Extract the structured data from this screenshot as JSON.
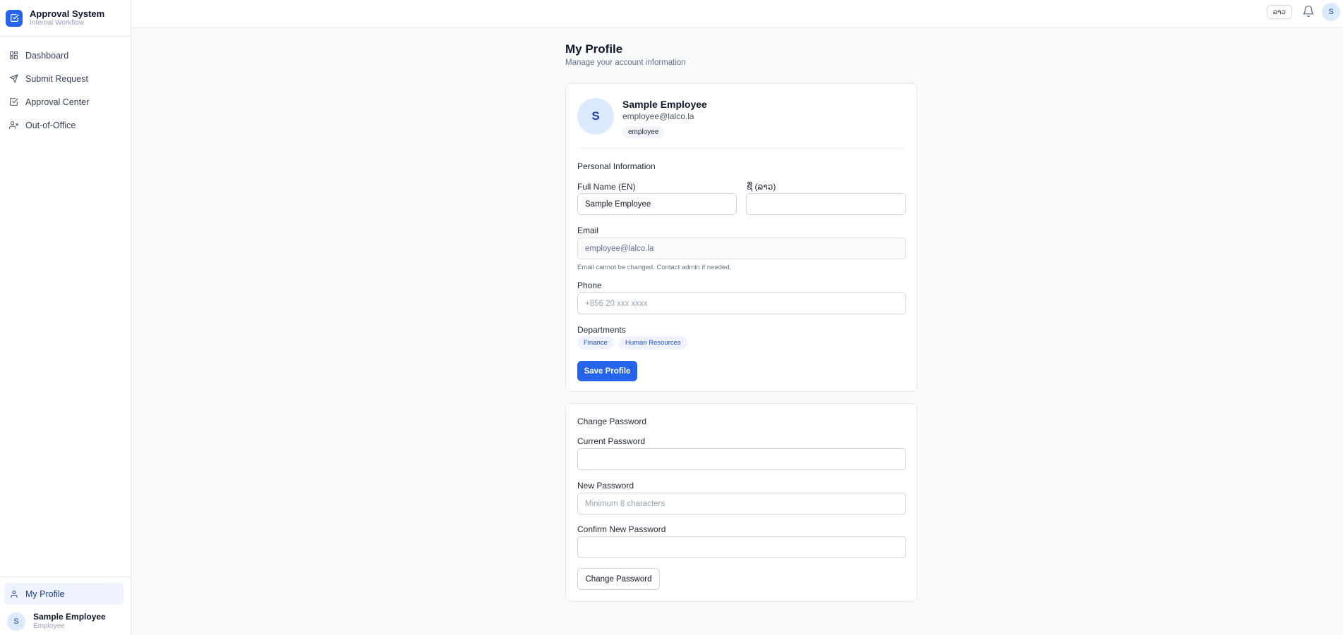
{
  "brand": {
    "title": "Approval System",
    "subtitle": "Internal Workflow"
  },
  "nav": {
    "items": [
      {
        "label": "Dashboard",
        "icon": "grid-icon"
      },
      {
        "label": "Submit Request",
        "icon": "send-icon"
      },
      {
        "label": "Approval Center",
        "icon": "check-square-icon"
      },
      {
        "label": "Out-of-Office",
        "icon": "user-x-icon"
      }
    ],
    "profile_label": "My Profile"
  },
  "sidebar_user": {
    "initial": "S",
    "name": "Sample Employee",
    "role": "Employee"
  },
  "topbar": {
    "language": "ລາວ",
    "avatar_initial": "S"
  },
  "page": {
    "title": "My Profile",
    "subtitle": "Manage your account information"
  },
  "profile": {
    "initial": "S",
    "name": "Sample Employee",
    "email": "employee@lalco.la",
    "role_badge": "employee"
  },
  "personal_info": {
    "section_title": "Personal Information",
    "full_name_en_label": "Full Name (EN)",
    "full_name_en_value": "Sample Employee",
    "name_lo_label": "ຊື່ (ລາວ)",
    "name_lo_value": "",
    "email_label": "Email",
    "email_value": "employee@lalco.la",
    "email_helper": "Email cannot be changed. Contact admin if needed.",
    "phone_label": "Phone",
    "phone_placeholder": "+856 20 xxx xxxx",
    "departments_label": "Departments",
    "departments": [
      "Finance",
      "Human Resources"
    ],
    "save_label": "Save Profile"
  },
  "password": {
    "section_title": "Change Password",
    "current_label": "Current Password",
    "new_label": "New Password",
    "new_placeholder": "Minimum 8 characters",
    "confirm_label": "Confirm New Password",
    "button_label": "Change Password"
  },
  "colors": {
    "accent": "#2563eb",
    "accent_light": "#eef3ff",
    "avatar_bg": "#dbeafe"
  }
}
